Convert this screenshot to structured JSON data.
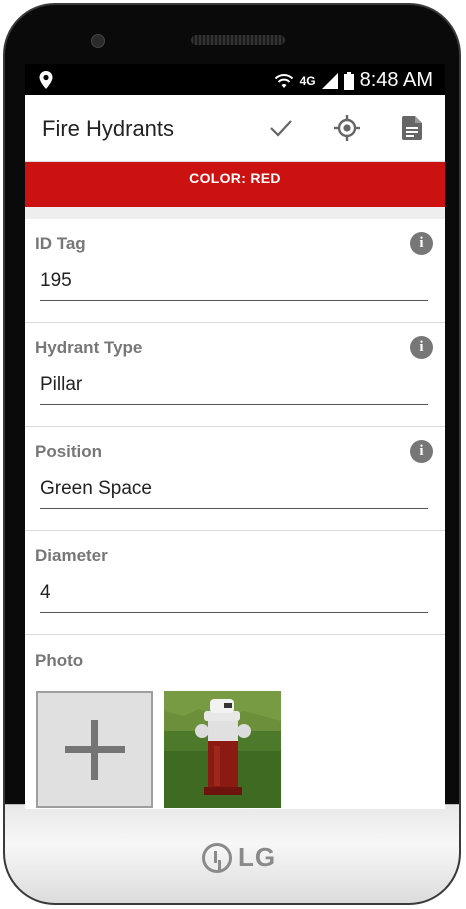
{
  "status_bar": {
    "time": "8:48 AM",
    "network": "4G"
  },
  "app_bar": {
    "title": "Fire Hydrants"
  },
  "banner": {
    "text": "COLOR: RED",
    "color": "#cc1111"
  },
  "fields": [
    {
      "label": "ID Tag",
      "value": "195",
      "has_info": true
    },
    {
      "label": "Hydrant Type",
      "value": "Pillar",
      "has_info": true
    },
    {
      "label": "Position",
      "value": "Green Space",
      "has_info": true
    },
    {
      "label": "Diameter",
      "value": "4",
      "has_info": false
    }
  ],
  "photo": {
    "label": "Photo"
  },
  "device": {
    "brand": "LG"
  },
  "icons": {
    "save": "check-icon",
    "locate": "gps-target-icon",
    "form": "document-icon",
    "info": "info-icon",
    "location_status": "location-pin-icon"
  }
}
